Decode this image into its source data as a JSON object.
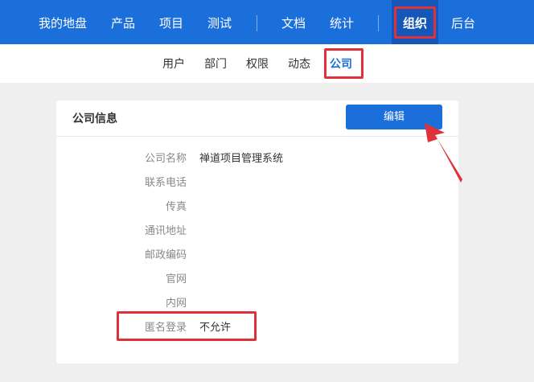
{
  "top_nav": {
    "items": [
      "我的地盘",
      "产品",
      "项目",
      "测试",
      "文档",
      "统计",
      "组织",
      "后台"
    ],
    "active": "组织"
  },
  "sub_nav": {
    "items": [
      "用户",
      "部门",
      "权限",
      "动态",
      "公司"
    ],
    "active": "公司"
  },
  "card": {
    "title": "公司信息",
    "edit_label": "编辑",
    "fields": [
      {
        "label": "公司名称",
        "value": "禅道项目管理系统"
      },
      {
        "label": "联系电话",
        "value": ""
      },
      {
        "label": "传真",
        "value": ""
      },
      {
        "label": "通讯地址",
        "value": ""
      },
      {
        "label": "邮政编码",
        "value": ""
      },
      {
        "label": "官网",
        "value": ""
      },
      {
        "label": "内网",
        "value": ""
      },
      {
        "label": "匿名登录",
        "value": "不允许"
      }
    ]
  },
  "colors": {
    "nav_blue": "#1b6fdb",
    "highlight_red": "#e0313b"
  }
}
